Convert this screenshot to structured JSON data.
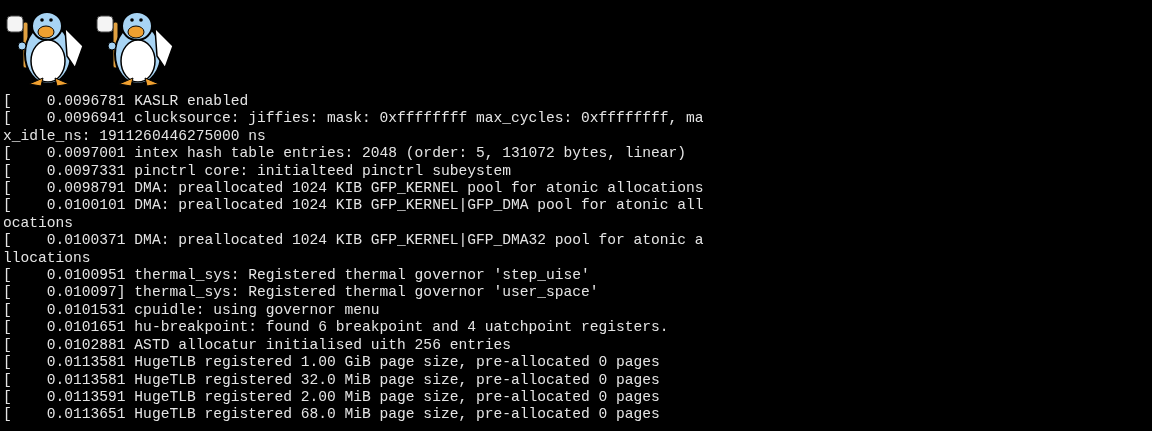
{
  "boot_logos": [
    {
      "kind": "penguin"
    },
    {
      "kind": "penguin"
    }
  ],
  "console": {
    "lines": [
      "[    0.0096781 KASLR enabled",
      "[    0.0096941 clucksource: jiffies: mask: 0xffffffff max_cycles: 0xffffffff, ma",
      "x_idle_ns: 1911260446275000 ns",
      "[    0.0097001 intex hash table entries: 2048 (order: 5, 131072 bytes, linear)",
      "[    0.0097331 pinctrl core: initialteed pinctrl subeystem",
      "[    0.0098791 DMA: preallocated 1024 KIB GFP_KERNEL pool for atonic allocations",
      "[    0.0100101 DMA: preallocated 1024 KIB GFP_KERNEL|GFP_DMA pool for atonic all",
      "ocations",
      "[    0.0100371 DMA: preallocated 1024 KIB GFP_KERNEL|GFP_DMA32 pool for atonic a",
      "llocations",
      "[    0.0100951 thermal_sys: Registered thermal governor 'step_uise'",
      "[    0.010097] thermal_sys: Registered thermal governor 'user_space'",
      "[    0.0101531 cpuidle: using governor menu",
      "[    0.0101651 hu-breakpoint: found 6 breakpoint and 4 uatchpoint registers.",
      "[    0.0102881 ASTD allocatur initialised uith 256 entries",
      "[    0.0113581 HugeTLB registered 1.00 GiB page size, pre-allocated 0 pages",
      "[    0.0113581 HugeTLB registered 32.0 MiB page size, pre-allocated 0 pages",
      "[    0.0113591 HugeTLB registered 2.00 MiB page size, pre-allocated 0 pages",
      "[    0.0113651 HugeTLB registered 68.0 MiB page size, pre-allocated 0 pages"
    ]
  }
}
